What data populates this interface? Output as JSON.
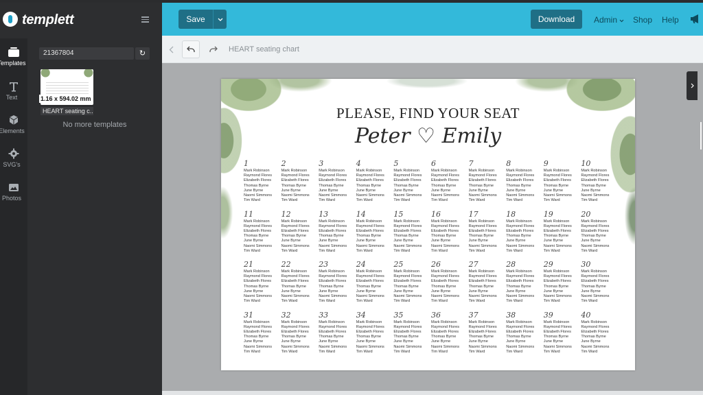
{
  "brand": {
    "name": "templett"
  },
  "nav": [
    {
      "label": "Templates",
      "icon": "templates-icon"
    },
    {
      "label": "Text",
      "icon": "text-icon"
    },
    {
      "label": "Elements",
      "icon": "elements-icon"
    },
    {
      "label": "SVG's",
      "icon": "svg-icon"
    },
    {
      "label": "Photos",
      "icon": "photos-icon"
    }
  ],
  "panel": {
    "search_value": "21367804",
    "thumb_dimensions": "1.16 x 594.02 mm",
    "thumb_name": "HEART seating c...",
    "no_more": "No more templates"
  },
  "topbar": {
    "save_label": "Save",
    "download_label": "Download",
    "admin_label": "Admin",
    "shop_label": "Shop",
    "help_label": "Help"
  },
  "toolbar": {
    "title": "HEART seating chart"
  },
  "document": {
    "heading": "PLEASE, FIND YOUR SEAT",
    "names": "Peter ♡ Emily",
    "guests": [
      "Mark Robinson",
      "Raymond Flores",
      "Elizabeth Flores",
      "Thomas Byrne",
      "June Byrne",
      "Naomi Simmons",
      "Tim Ward"
    ],
    "tables": [
      "1",
      "2",
      "3",
      "4",
      "5",
      "6",
      "7",
      "8",
      "9",
      "10",
      "11",
      "12",
      "13",
      "14",
      "15",
      "16",
      "17",
      "18",
      "19",
      "20",
      "21",
      "22",
      "23",
      "24",
      "25",
      "26",
      "27",
      "28",
      "29",
      "30",
      "31",
      "32",
      "33",
      "34",
      "35",
      "36",
      "37",
      "38",
      "39",
      "40"
    ]
  },
  "colors": {
    "header": "#33b9da",
    "button": "#1f6f86",
    "sidebar": "#2d2e30"
  }
}
